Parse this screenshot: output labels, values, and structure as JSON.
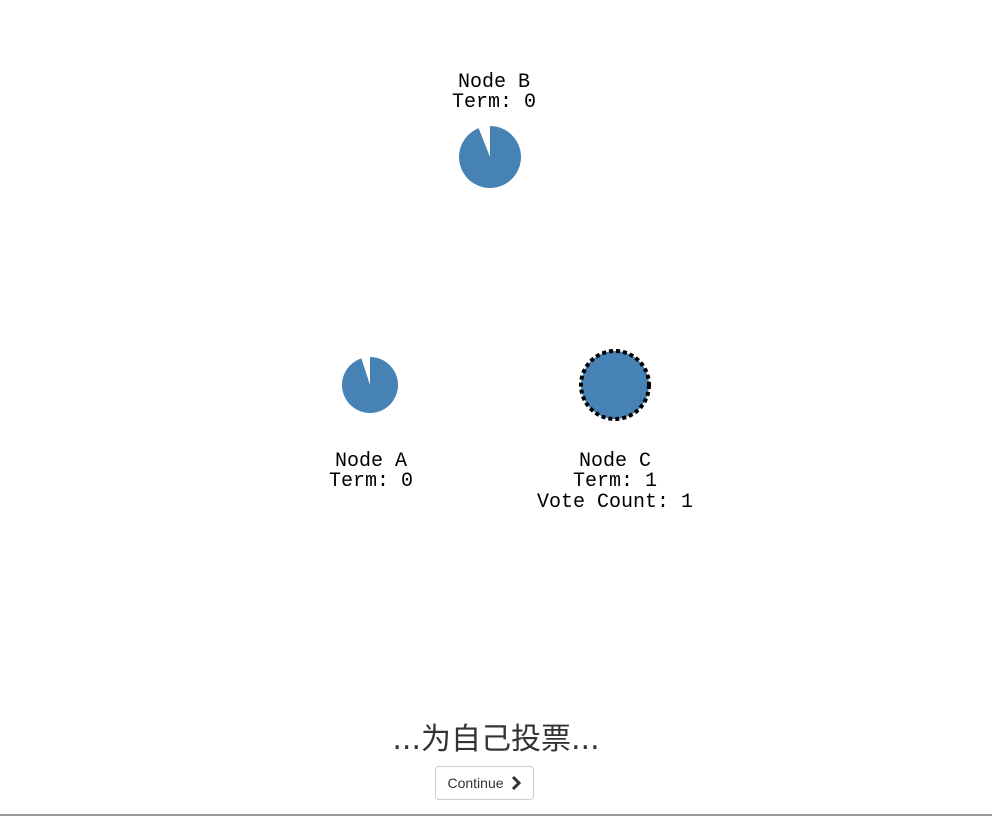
{
  "colors": {
    "node_fill": "#4682b4",
    "text": "#000000",
    "caption": "#333333"
  },
  "nodes": [
    {
      "id": "B",
      "label": "Node B",
      "term": "Term: 0",
      "timeout_remaining": 0.94,
      "voted_candidate_ring": false
    },
    {
      "id": "A",
      "label": "Node A",
      "term": "Term: 0",
      "timeout_remaining": 0.95,
      "voted_candidate_ring": false
    },
    {
      "id": "C",
      "label": "Node C",
      "term": "Term: 1",
      "vote_count": "Vote Count: 1",
      "timeout_remaining": 1.0,
      "voted_candidate_ring": true
    }
  ],
  "caption": "...为自己投票...",
  "continue_label": "Continue"
}
